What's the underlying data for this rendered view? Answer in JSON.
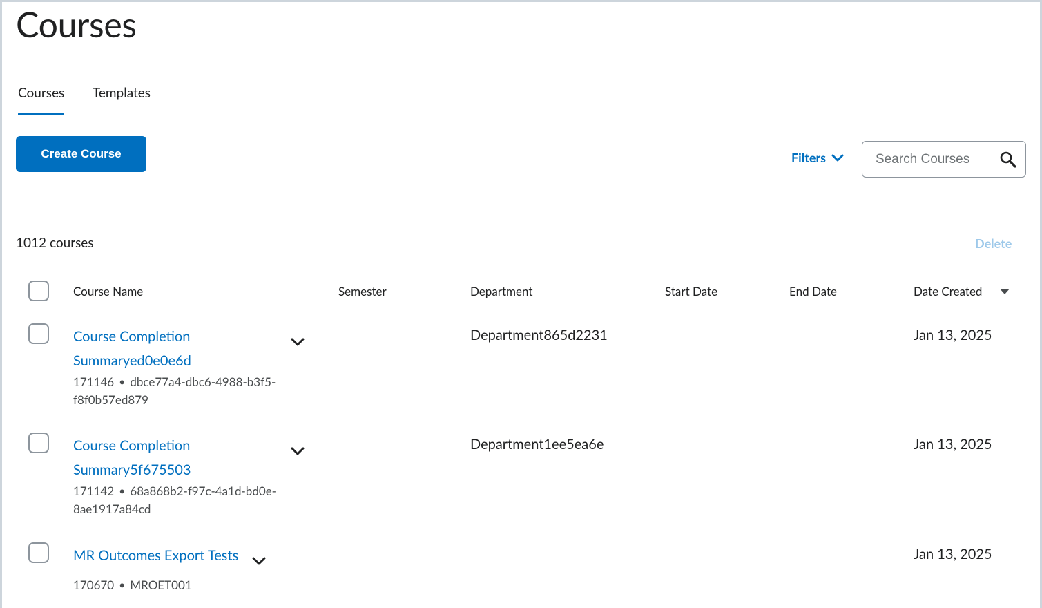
{
  "page": {
    "title": "Courses"
  },
  "tabs": [
    {
      "label": "Courses",
      "active": true
    },
    {
      "label": "Templates",
      "active": false
    }
  ],
  "toolbar": {
    "create_label": "Create Course",
    "filters_label": "Filters",
    "search_placeholder": "Search Courses",
    "delete_label": "Delete"
  },
  "summary": {
    "count_text": "1012 courses"
  },
  "columns": {
    "name": "Course Name",
    "semester": "Semester",
    "department": "Department",
    "start": "Start Date",
    "end": "End Date",
    "created": "Date Created"
  },
  "rows": [
    {
      "name_line1": "Course Completion",
      "name_line2": "Summaryed0e0e6d",
      "id": "171146",
      "code_line1": "dbce77a4-dbc6-4988-b3f5-",
      "code_line2": "f8f0b57ed879",
      "department": "Department865d2231",
      "created": "Jan 13, 2025"
    },
    {
      "name_line1": "Course Completion",
      "name_line2": "Summary5f675503",
      "id": "171142",
      "code_line1": "68a868b2-f97c-4a1d-bd0e-",
      "code_line2": "8ae1917a84cd",
      "department": "Department1ee5ea6e",
      "created": "Jan 13, 2025"
    },
    {
      "name_line1": "MR Outcomes Export Tests",
      "id": "170670",
      "code_line1": "MROET001",
      "department": "",
      "created": "Jan 13, 2025"
    }
  ],
  "icons": {
    "search": "search-icon",
    "filters": "chevron-down-icon",
    "sort": "caret-down-icon",
    "row_menu": "chevron-down-icon"
  },
  "colors": {
    "accent": "#006fbf",
    "delete_disabled": "#9ec9ea",
    "divider": "#e3e9f1"
  }
}
